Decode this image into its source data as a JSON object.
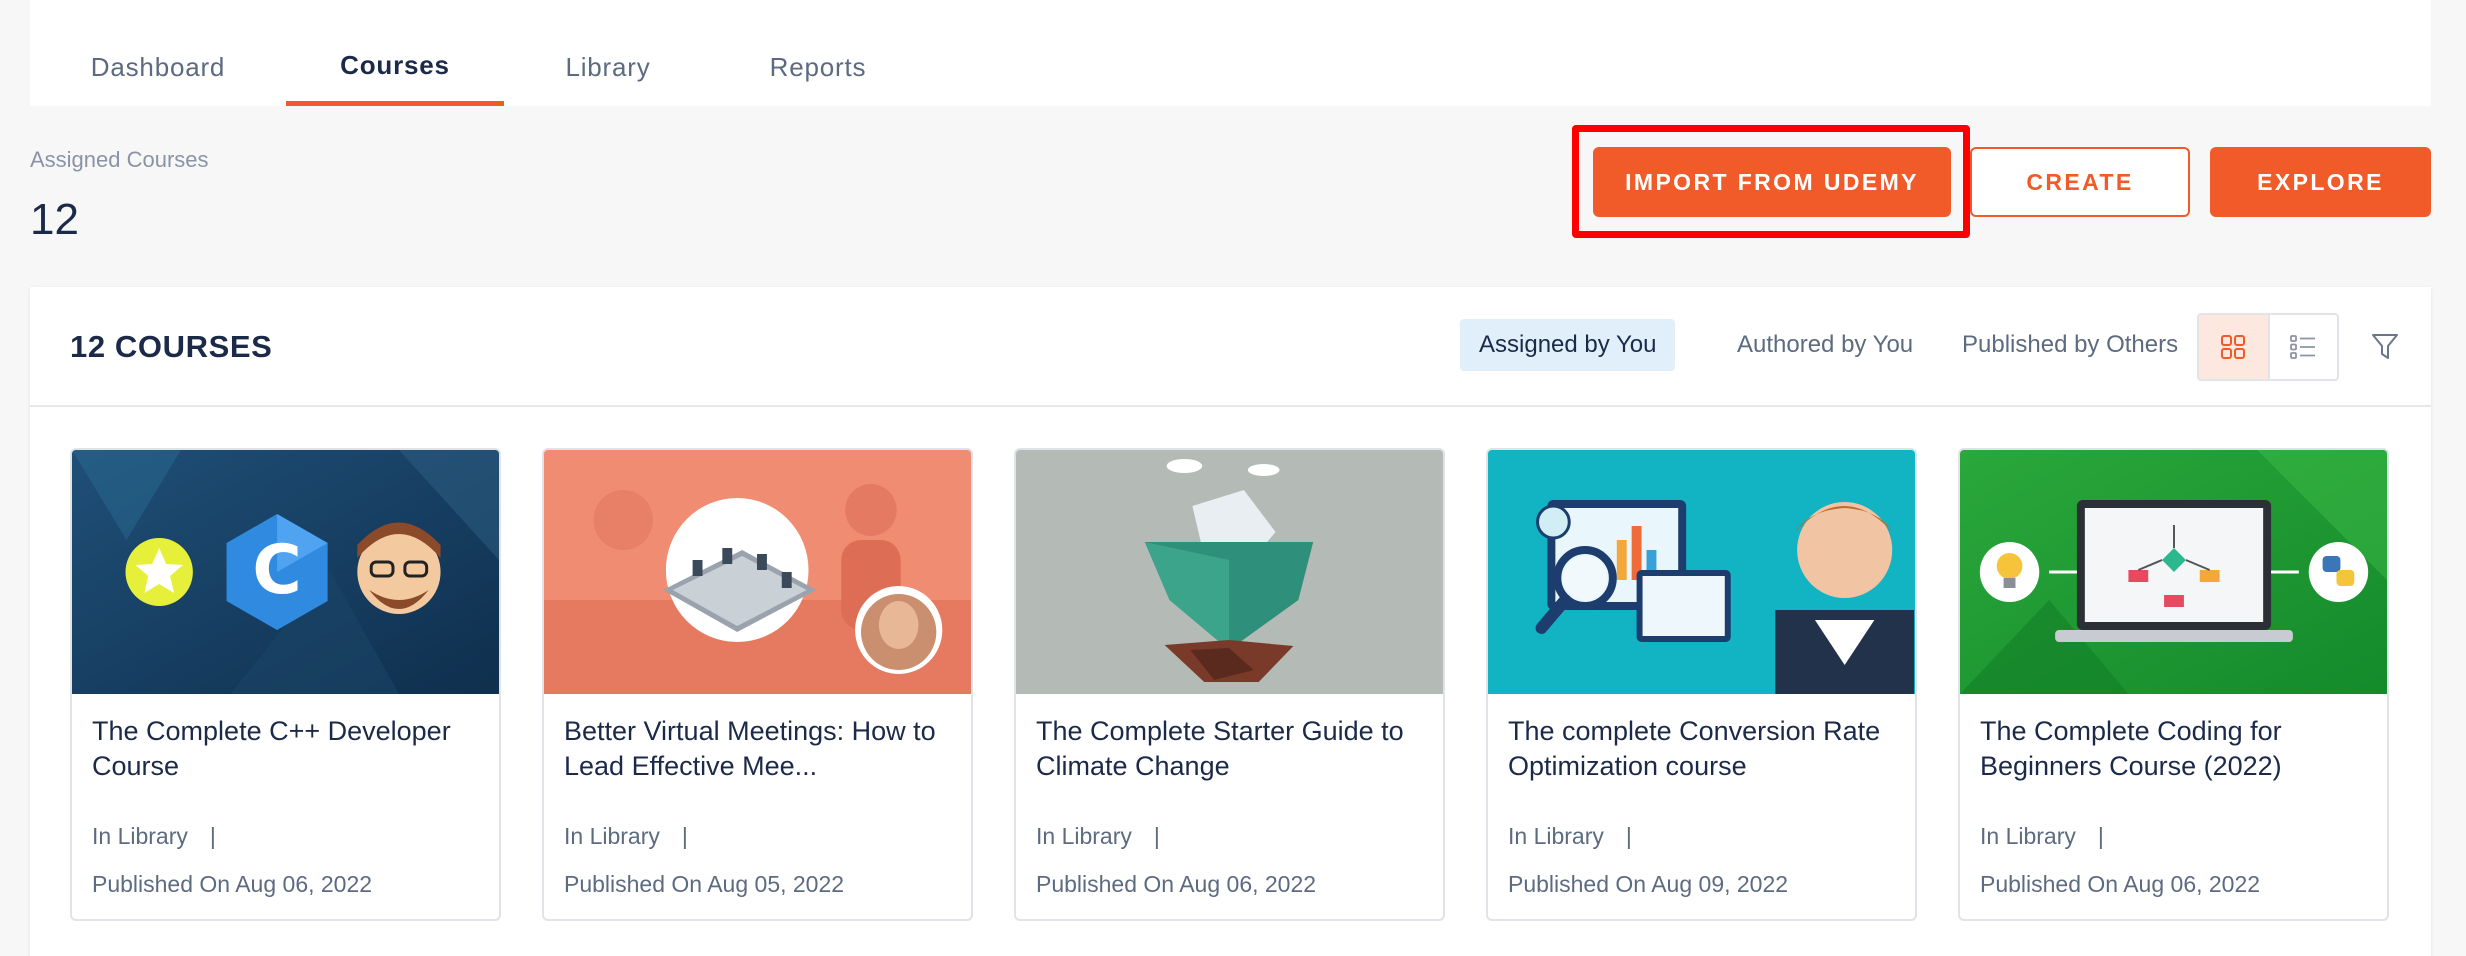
{
  "tabs": [
    {
      "label": "Dashboard",
      "active": false
    },
    {
      "label": "Courses",
      "active": true
    },
    {
      "label": "Library",
      "active": false
    },
    {
      "label": "Reports",
      "active": false
    }
  ],
  "summary": {
    "label": "Assigned Courses",
    "count": "12"
  },
  "actions": {
    "import_label": "IMPORT FROM UDEMY",
    "create_label": "CREATE",
    "explore_label": "EXPLORE"
  },
  "panel": {
    "title": "12 COURSES",
    "filters": [
      "Assigned by You",
      "Authored by You",
      "Published by Others"
    ],
    "active_filter": "Assigned by You",
    "view_mode": "grid"
  },
  "courses": [
    {
      "title": "The Complete C++ Developer Course",
      "status": "In Library",
      "separator": "|",
      "published": "Published On Aug 06, 2022",
      "thumb_icon": "cpp-logo-icon"
    },
    {
      "title": "Better Virtual Meetings: How to Lead Effective Mee...",
      "status": "In Library",
      "separator": "|",
      "published": "Published On Aug 05, 2022",
      "thumb_icon": "meeting-table-icon"
    },
    {
      "title": "The Complete Starter Guide to Climate Change",
      "status": "In Library",
      "separator": "|",
      "published": "Published On Aug 06, 2022",
      "thumb_icon": "iceberg-icon"
    },
    {
      "title": "The complete Conversion Rate Optimization course",
      "status": "In Library",
      "separator": "|",
      "published": "Published On Aug 09, 2022",
      "thumb_icon": "analytics-magnifier-icon"
    },
    {
      "title": "The Complete Coding for Beginners Course (2022)",
      "status": "In Library",
      "separator": "|",
      "published": "Published On Aug 06, 2022",
      "thumb_icon": "flowchart-laptop-icon"
    }
  ],
  "colors": {
    "accent": "#f15a29",
    "highlight": "#ff0000",
    "filter_active_bg": "#e1effb",
    "text_dark": "#1c2a4a",
    "text_muted": "#5d6b80"
  }
}
